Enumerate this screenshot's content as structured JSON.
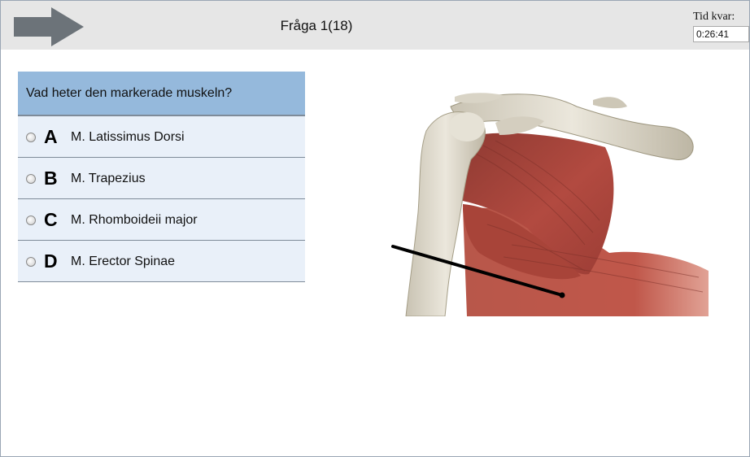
{
  "header": {
    "next_icon": "arrow-right-icon",
    "question_counter": "Fråga 1(18)",
    "timer_label": "Tid kvar:",
    "timer_value": "0:26:41"
  },
  "question": {
    "text": "Vad heter den markerade muskeln?"
  },
  "options": [
    {
      "letter": "A",
      "text": "M. Latissimus Dorsi"
    },
    {
      "letter": "B",
      "text": "M. Trapezius"
    },
    {
      "letter": "C",
      "text": "M. Rhomboideii major"
    },
    {
      "letter": "D",
      "text": "M. Erector Spinae"
    }
  ],
  "figure": {
    "subject": "shoulder-muscle-illustration",
    "colors": {
      "bone": "#ddd8ca",
      "muscle": "#a8433a",
      "pointer": "#000000"
    }
  }
}
